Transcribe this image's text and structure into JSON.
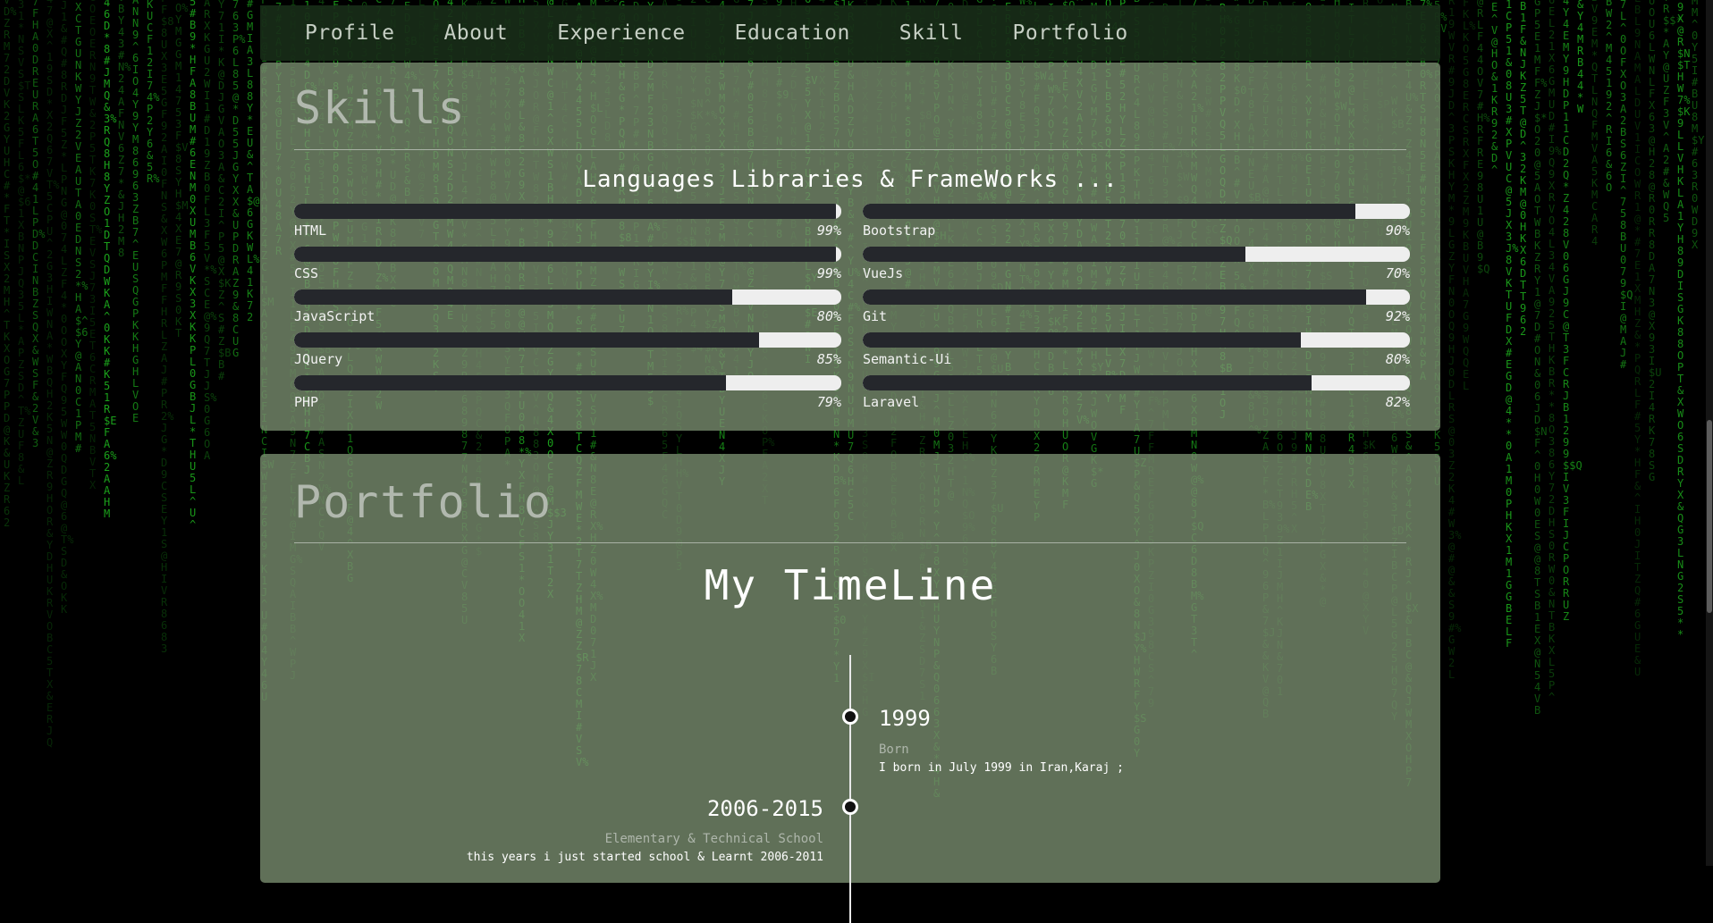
{
  "nav": {
    "items": [
      "Profile",
      "About",
      "Experience",
      "Education",
      "Skill",
      "Portfolio"
    ]
  },
  "skills_section": {
    "title": "Skills",
    "subtitle": "Languages Libraries & FrameWorks ...",
    "items": [
      {
        "name": "HTML",
        "percent": "99%",
        "value": 99
      },
      {
        "name": "Bootstrap",
        "percent": "90%",
        "value": 90
      },
      {
        "name": "CSS",
        "percent": "99%",
        "value": 99
      },
      {
        "name": "VueJs",
        "percent": "70%",
        "value": 70
      },
      {
        "name": "JavaScript",
        "percent": "80%",
        "value": 80
      },
      {
        "name": "Git",
        "percent": "92%",
        "value": 92
      },
      {
        "name": "JQuery",
        "percent": "85%",
        "value": 85
      },
      {
        "name": "Semantic-Ui",
        "percent": "80%",
        "value": 80
      },
      {
        "name": "PHP",
        "percent": "79%",
        "value": 79
      },
      {
        "name": "Laravel",
        "percent": "82%",
        "value": 82
      }
    ]
  },
  "portfolio_section": {
    "title": "Portfolio",
    "timeline_title": "My TimeLine",
    "events": [
      {
        "year": "1999",
        "heading": "Born",
        "text": "I born in July 1999 in Iran,Karaj ;"
      },
      {
        "year": "2006-2015",
        "heading": "Elementary & Technical School",
        "text": "this years i just started school & Learnt 2006-2011"
      }
    ]
  },
  "colors": {
    "matrix_green": "#1fb71f",
    "panel": "#788c6e",
    "navbar": "#182c18",
    "bar_track": "#eeeeee",
    "bar_fill": "#25272c"
  }
}
